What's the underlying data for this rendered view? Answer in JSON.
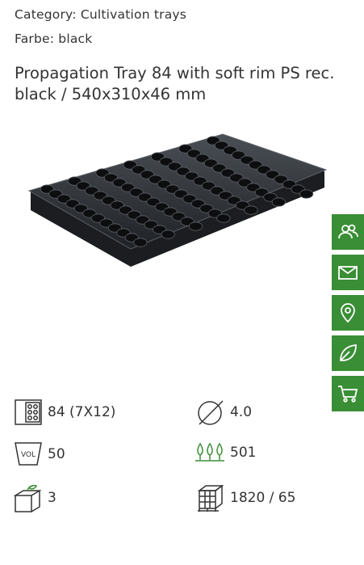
{
  "product": {
    "category": "Category: Cultivation trays",
    "color": "Farbe: black",
    "title": "Propagation Tray 84 with soft rim PS rec. black / 540x310x46 mm"
  },
  "sidebar": {
    "items": [
      {
        "icon": "contact-people-icon"
      },
      {
        "icon": "mail-icon"
      },
      {
        "icon": "location-pin-icon"
      },
      {
        "icon": "leaf-icon"
      },
      {
        "icon": "shopping-cart-icon"
      }
    ],
    "color": "#3a8e35"
  },
  "specs": {
    "cells": "84 (7X12)",
    "diameter": "4.0",
    "volume_badge": "VOL",
    "volume": "50",
    "plants": "501",
    "stack": "3",
    "pallet": "1820 / 65"
  }
}
